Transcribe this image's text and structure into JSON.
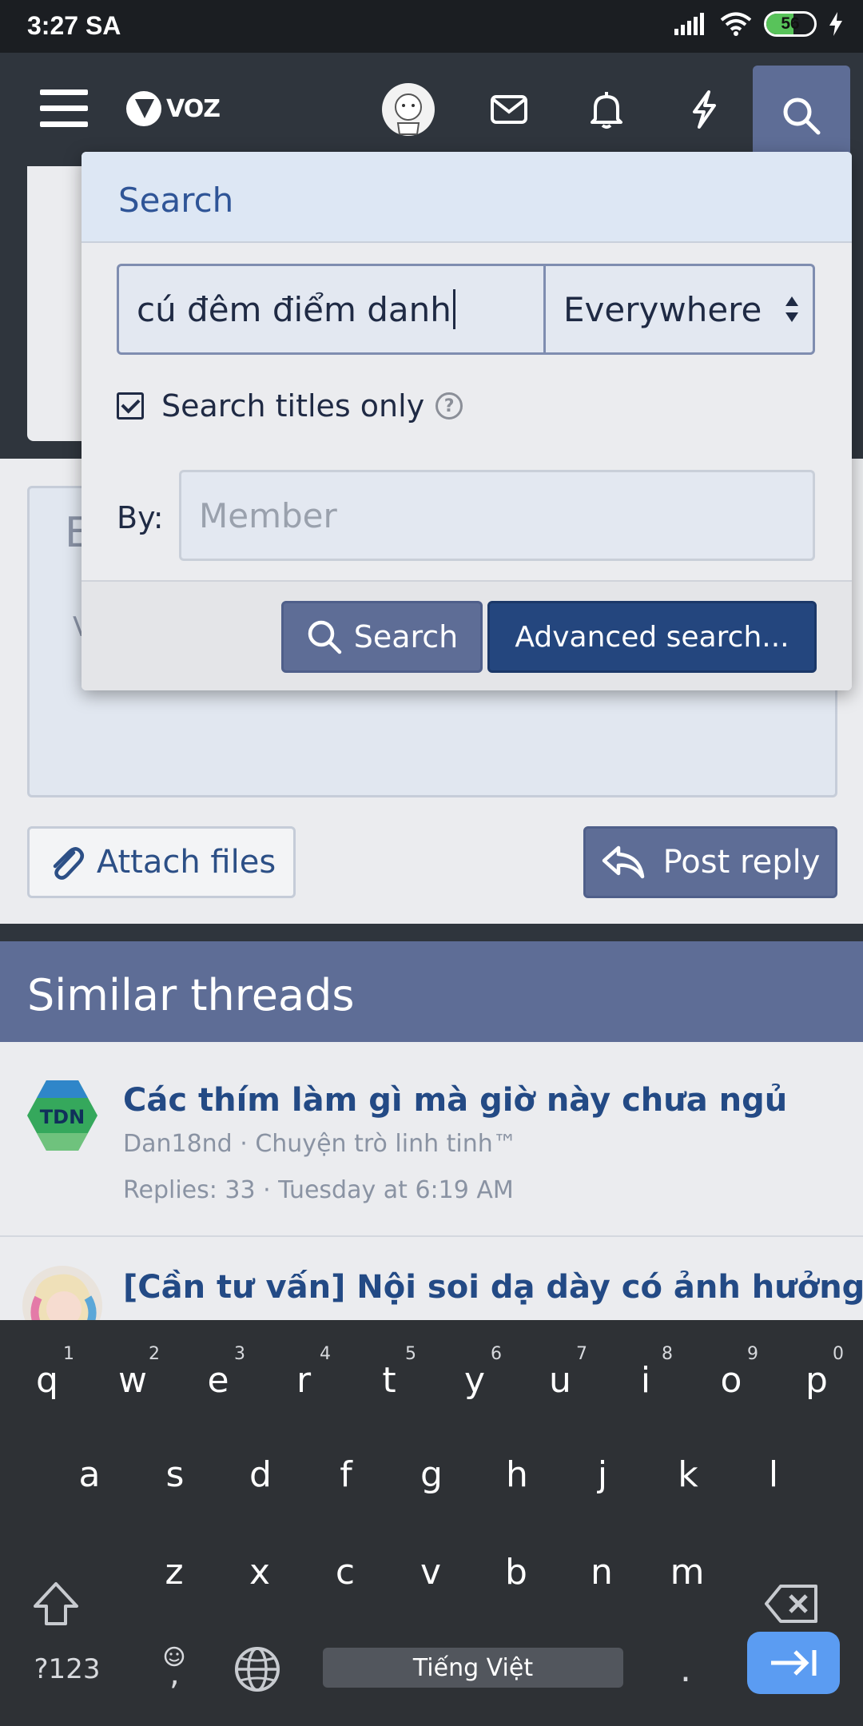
{
  "status_bar": {
    "time": "3:27 SA",
    "battery": "56",
    "battery_level": 0.56
  },
  "header": {
    "logo_text": "VOZ"
  },
  "page": {
    "editor_peek_1": "E",
    "editor_peek_2": "V"
  },
  "actions": {
    "attach_label": "Attach files",
    "reply_label": "Post reply"
  },
  "similar": {
    "title": "Similar threads",
    "threads": [
      {
        "avatar_text": "TDN",
        "title": "Các thím làm gì mà giờ này chưa ngủ",
        "byline": "Dan18nd · Chuyện trò linh tinh™",
        "stats": "Replies: 33 · Tuesday at 6:19 AM"
      },
      {
        "avatar_text": "",
        "title": "[Cần tư vấn] Nội soi dạ dày có ảnh hưởng"
      }
    ]
  },
  "search_popup": {
    "title": "Search",
    "query": "cú đêm điểm danh",
    "scope": "Everywhere",
    "titles_only_label": "Search titles only",
    "titles_only_checked": true,
    "help": "?",
    "by_label": "By:",
    "member_placeholder": "Member",
    "search_button": "Search",
    "advanced_button": "Advanced search..."
  },
  "keyboard": {
    "row1": [
      "q",
      "w",
      "e",
      "r",
      "t",
      "y",
      "u",
      "i",
      "o",
      "p"
    ],
    "row1_hints": [
      "1",
      "2",
      "3",
      "4",
      "5",
      "6",
      "7",
      "8",
      "9",
      "0"
    ],
    "row2": [
      "a",
      "s",
      "d",
      "f",
      "g",
      "h",
      "j",
      "k",
      "l"
    ],
    "row3": [
      "z",
      "x",
      "c",
      "v",
      "b",
      "n",
      "m"
    ],
    "symbols_key": "?123",
    "comma_key": ",",
    "period_key": ".",
    "space_label": "Tiếng Việt"
  }
}
